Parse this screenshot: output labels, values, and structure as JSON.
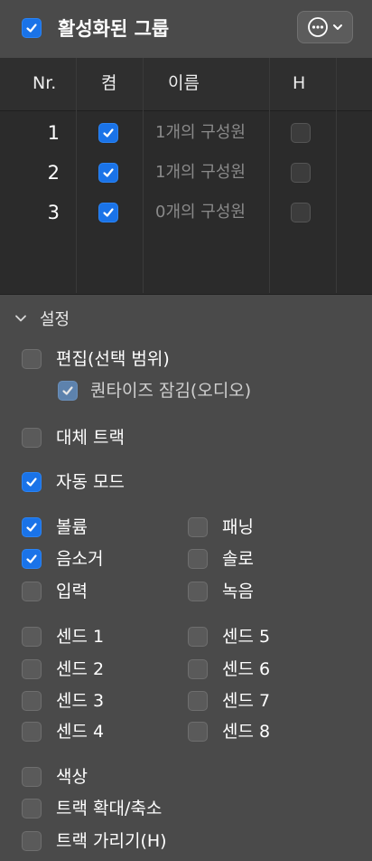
{
  "header": {
    "enabled_checked": true,
    "title": "활성화된 그룹",
    "more_icon": "ellipsis-circle-icon",
    "dropdown_icon": "chevron-down-icon"
  },
  "table": {
    "columns": [
      "Nr.",
      "켬",
      "이름",
      "H"
    ],
    "rows": [
      {
        "nr": "1",
        "on": true,
        "name": "1개의 구성원",
        "h": false
      },
      {
        "nr": "2",
        "on": true,
        "name": "1개의 구성원",
        "h": false
      },
      {
        "nr": "3",
        "on": true,
        "name": "0개의 구성원",
        "h": false
      }
    ]
  },
  "settings": {
    "title": "설정",
    "edit_label": "편집(선택 범위)",
    "quantize_label": "퀀타이즈 잠김(오디오)",
    "take_label": "대체 트랙",
    "auto_label": "자동 모드",
    "volume_label": "볼륨",
    "pan_label": "패닝",
    "mute_label": "음소거",
    "solo_label": "솔로",
    "input_label": "입력",
    "record_label": "녹음",
    "send1": "센드 1",
    "send2": "센드 2",
    "send3": "센드 3",
    "send4": "센드 4",
    "send5": "센드 5",
    "send6": "센드 6",
    "send7": "센드 7",
    "send8": "센드 8",
    "color_label": "색상",
    "zoom_label": "트랙 확대/축소",
    "hide_label": "트랙 가리기(H)"
  },
  "colors": {
    "accent": "#1a73e8",
    "background": "#4a4a4a",
    "table_bg": "#2b2b2b"
  }
}
